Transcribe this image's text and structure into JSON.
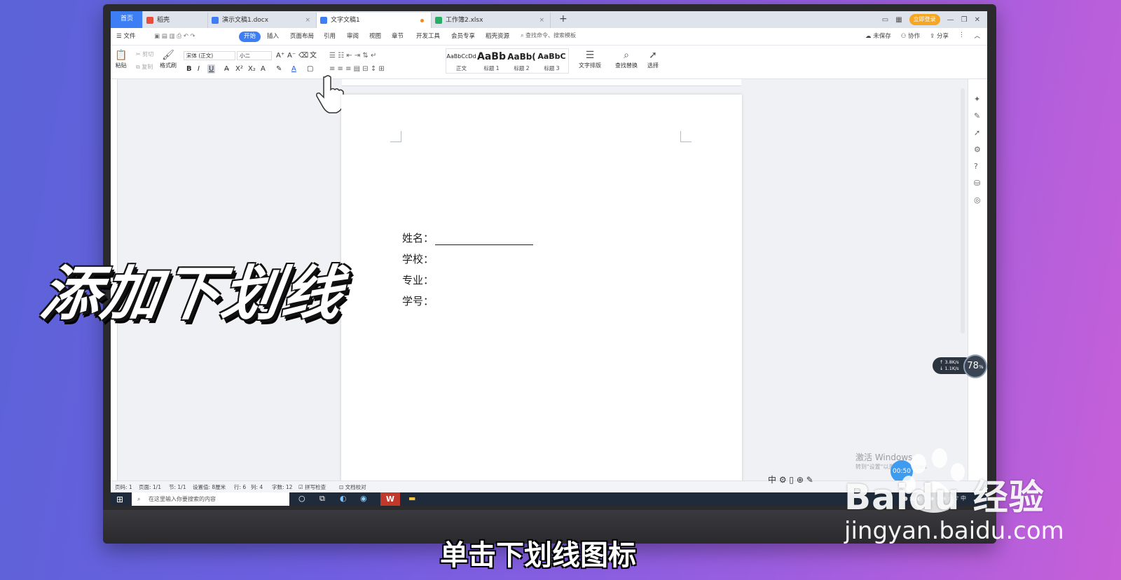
{
  "tabs": [
    {
      "label": "首页"
    },
    {
      "label": "稻壳"
    },
    {
      "label": "演示文稿1.docx"
    },
    {
      "label": "文字文稿1"
    },
    {
      "label": "工作簿2.xlsx"
    }
  ],
  "top_right": {
    "login": "立即登录"
  },
  "menu": {
    "file": "文件",
    "items": [
      "开始",
      "插入",
      "页面布局",
      "引用",
      "审阅",
      "视图",
      "章节",
      "开发工具",
      "会员专享",
      "稻壳资源"
    ],
    "search": "查找命令、搜索模板",
    "unsaved": "未保存",
    "collab": "协作",
    "share": "分享"
  },
  "ribbon": {
    "paste": "粘贴",
    "cut": "剪切",
    "copy": "复制",
    "format_painter": "格式刷",
    "font_name": "宋体 (正文)",
    "font_size": "小二",
    "styles": [
      {
        "sample": "AaBbCcDd",
        "name": "正文"
      },
      {
        "sample": "AaBb",
        "name": "标题 1"
      },
      {
        "sample": "AaBb(",
        "name": "标题 2"
      },
      {
        "sample": "AaBbC",
        "name": "标题 3"
      }
    ],
    "text_layout": "文字排版",
    "find_replace": "查找替换",
    "select": "选择"
  },
  "document": {
    "lines": [
      "姓名：",
      "学校：",
      "专业：",
      "学号："
    ]
  },
  "status": {
    "page": "页码: 1",
    "pages": "页面: 1/1",
    "section": "节: 1/1",
    "setting": "设置值: 8厘米",
    "row": "行: 6",
    "col": "列: 4",
    "words": "字数: 12",
    "spell": "拼写检查",
    "proof": "文档校对"
  },
  "taskbar": {
    "search_placeholder": "在这里输入你要搜索的内容"
  },
  "widgets": {
    "upload": "3.8",
    "download": "1.1",
    "net_percent": "78",
    "activate": "激活 Windows",
    "activate_sub": "转到\"设置\"以激活 Windows",
    "timer": "00:50",
    "ime": "中"
  },
  "overlay": {
    "title": "添加下划线",
    "subtitle": "单击下划线图标",
    "watermark_url": "jingyan.baidu.com",
    "watermark_logo": "Baidu 经验"
  },
  "colors": {
    "accent": "#3d7ef5",
    "wps_red": "#c0392b"
  }
}
